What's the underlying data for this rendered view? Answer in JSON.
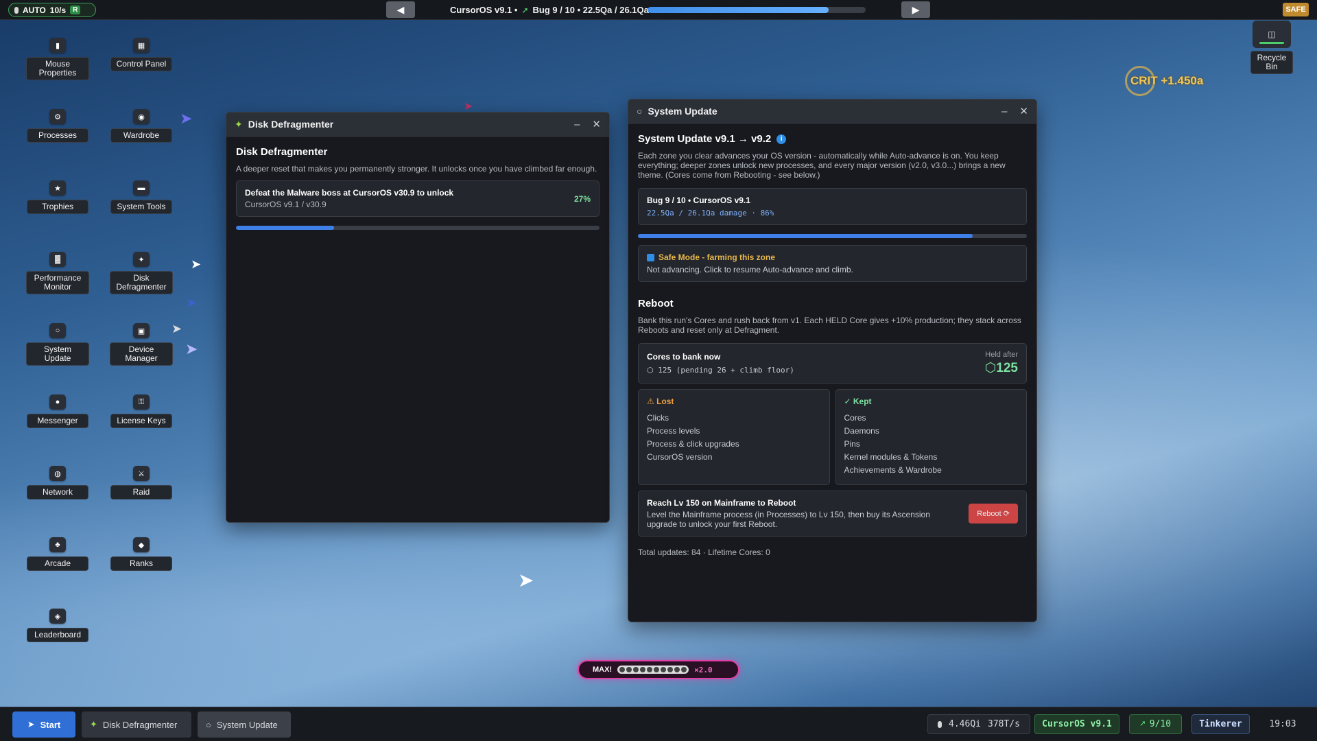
{
  "topbar": {
    "auto_label": "AUTO",
    "rate": "10/s",
    "r_badge": "R",
    "title_version": "CursorOS v9.1 •",
    "title_bug": "Bug 9 / 10 • 22.5Qa / 26.1Qa",
    "progress_fraction": 0.83,
    "prev_icon": "◀",
    "next_icon": "▶",
    "safe_label": "SAFE"
  },
  "desktop": {
    "icons": [
      {
        "label": "Mouse Properties",
        "icon": "mouse-icon",
        "glyph": "▮"
      },
      {
        "label": "Control Panel",
        "icon": "control-panel-icon",
        "glyph": "▦"
      },
      {
        "label": "Processes",
        "icon": "gear-icon",
        "glyph": "⚙"
      },
      {
        "label": "Wardrobe",
        "icon": "palette-icon",
        "glyph": "◉"
      },
      {
        "label": "Trophies",
        "icon": "trophy-icon",
        "glyph": "★"
      },
      {
        "label": "System Tools",
        "icon": "toolbox-icon",
        "glyph": "▬"
      },
      {
        "label": "Performance Monitor",
        "icon": "chart-icon",
        "glyph": "▓"
      },
      {
        "label": "Disk Defragmenter",
        "icon": "puzzle-icon",
        "glyph": "✦"
      },
      {
        "label": "System Update",
        "icon": "update-icon",
        "glyph": "○"
      },
      {
        "label": "Device Manager",
        "icon": "monitor-icon",
        "glyph": "▣"
      },
      {
        "label": "Messenger",
        "icon": "chat-icon",
        "glyph": "●"
      },
      {
        "label": "License Keys",
        "icon": "key-icon",
        "glyph": "⚿"
      },
      {
        "label": "Network",
        "icon": "globe-icon",
        "glyph": "◍"
      },
      {
        "label": "Raid",
        "icon": "swords-icon",
        "glyph": "⚔"
      },
      {
        "label": "Arcade",
        "icon": "joystick-icon",
        "glyph": "♣"
      },
      {
        "label": "Ranks",
        "icon": "medal-icon",
        "glyph": "◆"
      },
      {
        "label": "Leaderboard",
        "icon": "leaderboard-icon",
        "glyph": "◈"
      }
    ],
    "recycle_bin": "Recycle Bin",
    "crit_text": "CRIT +1.450a"
  },
  "defrag": {
    "title": "Disk Defragmenter",
    "heading": "Disk Defragmenter",
    "description": "A deeper reset that makes you permanently stronger. It unlocks once you have climbed far enough.",
    "unlock_title": "Defeat the Malware boss at CursorOS v30.9 to unlock",
    "unlock_sub": "CursorOS v9.1 / v30.9",
    "unlock_percent": "27%",
    "progress_fraction": 0.27
  },
  "update": {
    "title": "System Update",
    "heading": "System Update v9.1 → v9.2",
    "info_icon": "i",
    "description": "Each zone you clear advances your OS version - automatically while Auto-advance is on. You keep everything; deeper zones unlock new processes, and every major version (v2.0, v3.0...) brings a new theme. (Cores come from Rebooting - see below.)",
    "bug_title": "Bug 9 / 10 • CursorOS v9.1",
    "bug_sub": "22.5Qa / 26.1Qa damage · 86%",
    "progress_fraction": 0.86,
    "safe_title": "Safe Mode - farming this zone",
    "safe_sub": "Not advancing. Click to resume Auto-advance and climb.",
    "reboot_heading": "Reboot",
    "reboot_desc": "Bank this run's Cores and rush back from v1. Each HELD Core gives +10% production; they stack across Reboots and reset only at Defragment.",
    "cores_title": "Cores to bank now",
    "cores_sub": "⬡ 125 (pending 26 + climb floor)",
    "held_label": "Held after",
    "held_value": "⬡125",
    "lost_title": "⚠ Lost",
    "lost_items": [
      "Clicks",
      "Process levels",
      "Process & click upgrades",
      "CursorOS version"
    ],
    "kept_title": "✓ Kept",
    "kept_items": [
      "Cores",
      "Daemons",
      "Pins",
      "Kernel modules & Tokens",
      "Achievements & Wardrobe"
    ],
    "reach_title": "Reach Lv 150 on Mainframe to Reboot",
    "reach_desc": "Level the Mainframe process (in Processes) to Lv 150, then buy its Ascension upgrade to unlock your first Reboot.",
    "reboot_button": "Reboot ⟳",
    "footer": "Total updates: 84 · Lifetime Cores: 0"
  },
  "combo": {
    "label": "MAX!",
    "multiplier": "×2.0"
  },
  "taskbar": {
    "start": "Start",
    "items": [
      "Disk Defragmenter",
      "System Update"
    ],
    "stat_currency": "4.46Qi",
    "stat_rate": "378T/s",
    "version": "CursorOS v9.1",
    "bugs": "9/10",
    "rank": "Tinkerer",
    "clock": "19:03"
  },
  "colors": {
    "accent_blue": "#3f7fe8",
    "safe_yellow": "#e8b84a",
    "lost_orange": "#f0a040",
    "kept_green": "#7ee2a0",
    "danger_red": "#e04848",
    "combo_pink": "#e040a8"
  }
}
